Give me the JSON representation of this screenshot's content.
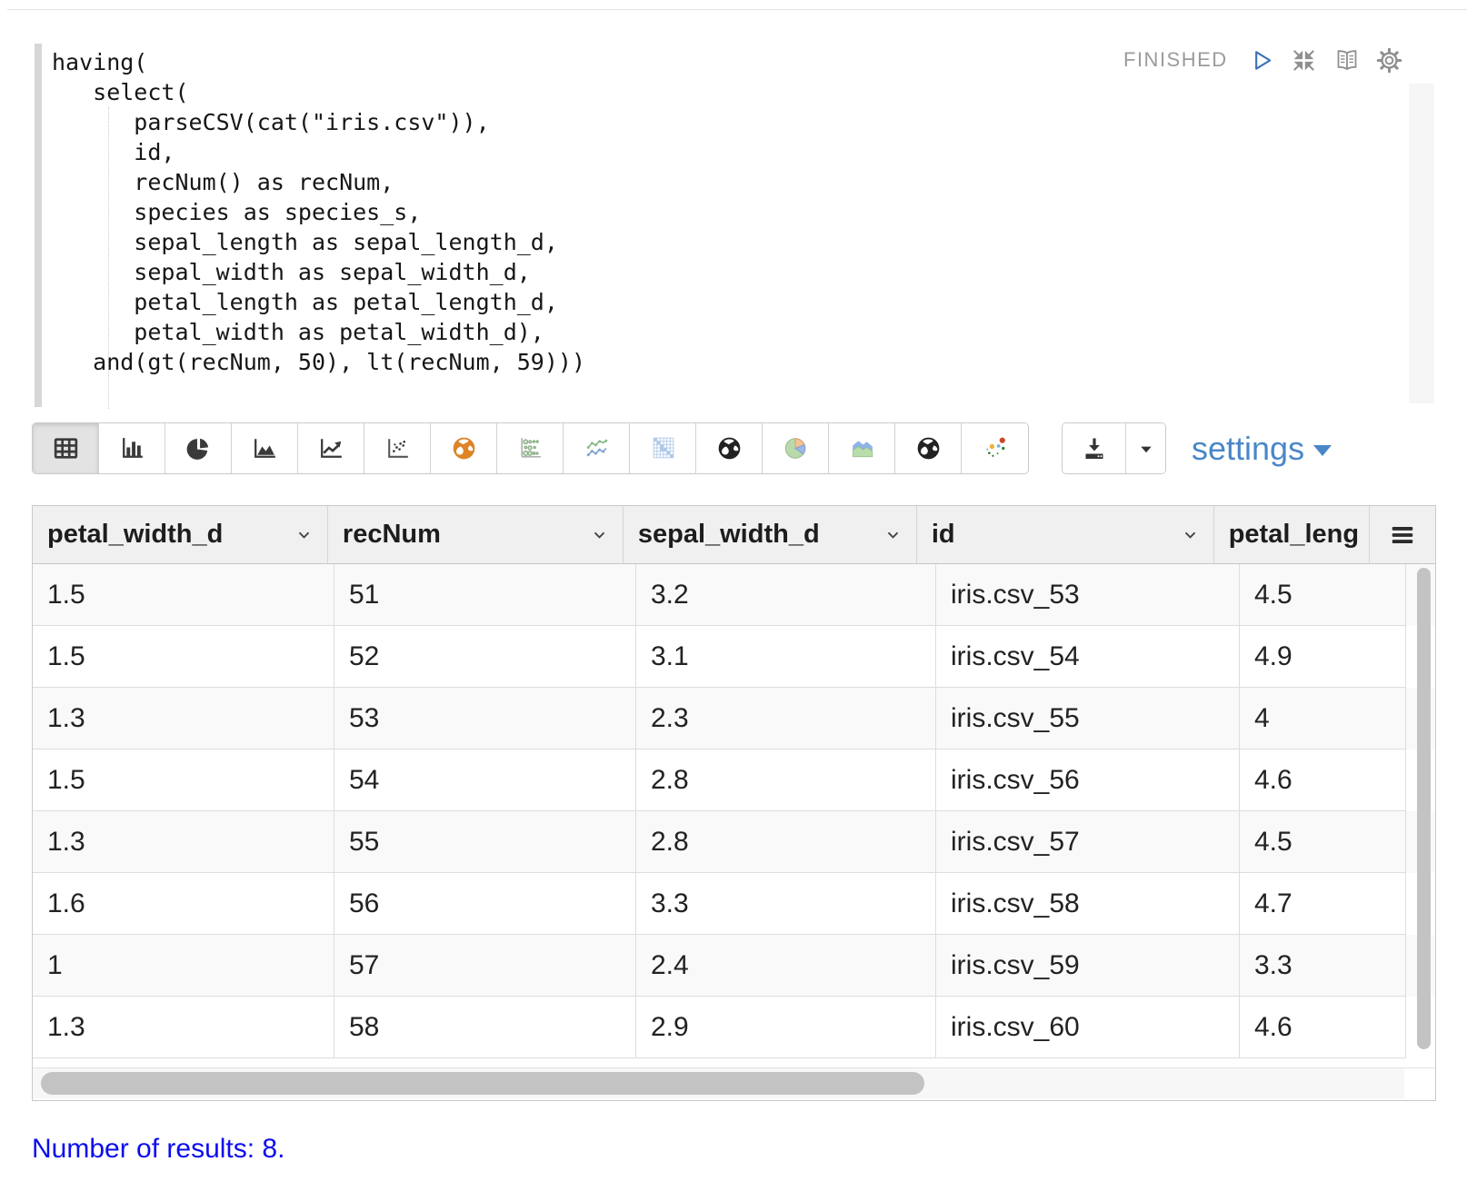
{
  "paragraph": {
    "status": "FINISHED",
    "code_lines": [
      "having(",
      "   select(",
      "      parseCSV(cat(\"iris.csv\")),",
      "      id,",
      "      recNum() as recNum,",
      "      species as species_s,",
      "      sepal_length as sepal_length_d,",
      "      sepal_width as sepal_width_d,",
      "      petal_length as petal_length_d,",
      "      petal_width as petal_width_d),",
      "   and(gt(recNum, 50), lt(recNum, 59)))"
    ]
  },
  "toolbar": {
    "settings_label": "settings",
    "chart_buttons": [
      {
        "name": "table-view",
        "icon": "table-icon",
        "active": true
      },
      {
        "name": "bar-chart",
        "icon": "bar-chart-icon",
        "active": false
      },
      {
        "name": "pie-chart",
        "icon": "pie-chart-icon",
        "active": false
      },
      {
        "name": "area-chart",
        "icon": "area-chart-icon",
        "active": false
      },
      {
        "name": "line-chart",
        "icon": "line-chart-icon",
        "active": false
      },
      {
        "name": "scatter-chart",
        "icon": "scatter-chart-icon",
        "active": false
      },
      {
        "name": "map-chart",
        "icon": "globe-orange-icon",
        "active": false
      },
      {
        "name": "bubble-chart",
        "icon": "bubble-chart-icon",
        "active": false
      },
      {
        "name": "multi-line-chart",
        "icon": "multi-line-chart-icon",
        "active": false
      },
      {
        "name": "heatmap-chart",
        "icon": "heatmap-icon",
        "active": false
      },
      {
        "name": "globe-chart",
        "icon": "globe-dark-icon",
        "active": false
      },
      {
        "name": "pie-chart-alt",
        "icon": "pie-pastel-icon",
        "active": false
      },
      {
        "name": "area-chart-alt",
        "icon": "area-pastel-icon",
        "active": false
      },
      {
        "name": "globe-chart-2",
        "icon": "globe-dark-icon",
        "active": false
      },
      {
        "name": "scatter-chart-alt",
        "icon": "scatter-color-icon",
        "active": false
      }
    ],
    "icons": {
      "run-icon": "play-triangle-outline",
      "collapse-icon": "arrows-inward",
      "reader-icon": "open-book",
      "gear-icon": "gear",
      "download-icon": "download-tray",
      "caret-down-icon": "caret-down",
      "menu-icon": "hamburger",
      "chevron-down-icon": "chevron-down"
    }
  },
  "table": {
    "columns": [
      {
        "label": "petal_width_d",
        "sort_icon": true
      },
      {
        "label": "recNum",
        "sort_icon": true
      },
      {
        "label": "sepal_width_d",
        "sort_icon": true
      },
      {
        "label": "id",
        "sort_icon": true
      },
      {
        "label": "petal_leng",
        "sort_icon": false
      }
    ],
    "rows": [
      [
        "1.5",
        "51",
        "3.2",
        "iris.csv_53",
        "4.5"
      ],
      [
        "1.5",
        "52",
        "3.1",
        "iris.csv_54",
        "4.9"
      ],
      [
        "1.3",
        "53",
        "2.3",
        "iris.csv_55",
        "4"
      ],
      [
        "1.5",
        "54",
        "2.8",
        "iris.csv_56",
        "4.6"
      ],
      [
        "1.3",
        "55",
        "2.8",
        "iris.csv_57",
        "4.5"
      ],
      [
        "1.6",
        "56",
        "3.3",
        "iris.csv_58",
        "4.7"
      ],
      [
        "1",
        "57",
        "2.4",
        "iris.csv_59",
        "3.3"
      ],
      [
        "1.3",
        "58",
        "2.9",
        "iris.csv_60",
        "4.6"
      ]
    ]
  },
  "footer": {
    "results_text": "Number of results: 8."
  },
  "colors": {
    "settings_link": "#4a87c8",
    "results_text": "#0c0cee",
    "status_text": "#9b9b9b",
    "play_accent": "#3d72b8",
    "map_icon_orange": "#dd8427"
  }
}
